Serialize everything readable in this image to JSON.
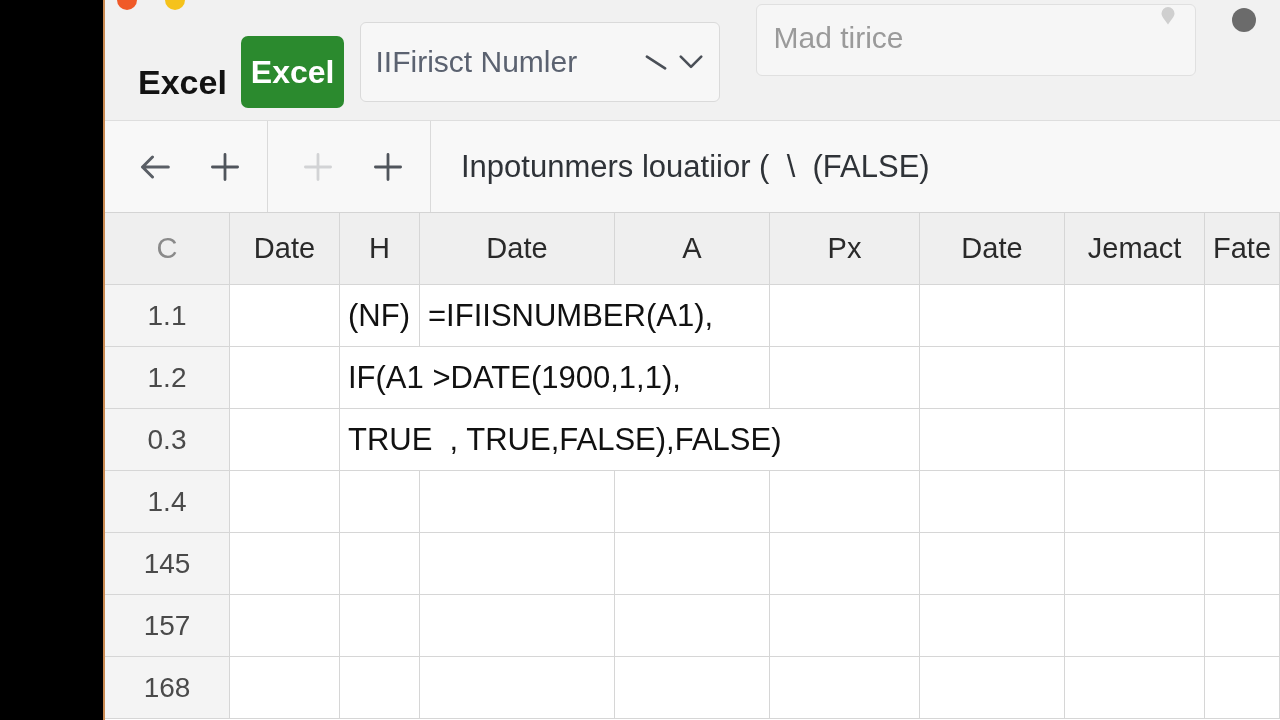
{
  "window": {
    "controls": [
      {
        "color": "#f05a28"
      },
      {
        "color": "#f5c21b"
      }
    ]
  },
  "header": {
    "app_name": "Excel",
    "badge": "Excel",
    "name_box": {
      "value": "IIFirisct Numler"
    },
    "search": {
      "placeholder": "Mad tirice"
    }
  },
  "toolbar": {
    "groups": [
      [
        {
          "kind": "back",
          "disabled": false
        },
        {
          "kind": "add",
          "disabled": false
        }
      ],
      [
        {
          "kind": "add",
          "disabled": true
        },
        {
          "kind": "add",
          "disabled": false
        }
      ]
    ],
    "formula": "Inpotunmers louatiior (  \\  (FALSE)"
  },
  "sheet": {
    "corner": "C",
    "columns": [
      "Date",
      "H",
      "Date",
      "A",
      "Px",
      "Date",
      "Jemact",
      "Fate"
    ],
    "rows": [
      {
        "header": "1.1",
        "cells": [
          null,
          "(NF)",
          "=IFIISNUMBER(A1),"
        ]
      },
      {
        "header": "1.2",
        "cells": [
          null,
          "IF(A1 >DATE(1900,1,1),"
        ]
      },
      {
        "header": "0.3",
        "cells": [
          null,
          "TRUE  , TRUE,FALSE),FALSE)"
        ]
      },
      {
        "header": "1.4"
      },
      {
        "header": "145"
      },
      {
        "header": "157"
      },
      {
        "header": "168"
      }
    ]
  }
}
